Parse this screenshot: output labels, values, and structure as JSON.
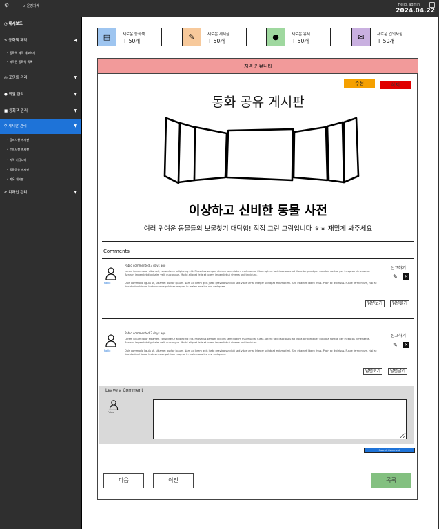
{
  "topbar": {
    "logo": "⚙",
    "home": "운영자계",
    "greeting": "Hello, admin",
    "date": "2024.04.22"
  },
  "sidebar": {
    "items": [
      {
        "label": "대시보드",
        "icon": "speedometer-icon"
      },
      {
        "label": "동화책 제작",
        "icon": "pen-icon"
      },
      {
        "label": "포인트 관리",
        "icon": "coin-icon"
      },
      {
        "label": "회원 관리",
        "icon": "user-icon"
      },
      {
        "label": "동화책 관리",
        "icon": "book-icon"
      },
      {
        "label": "게시판 관리",
        "icon": "board-icon"
      },
      {
        "label": "디자인 관리",
        "icon": "brush-icon"
      }
    ],
    "sub_create": [
      "동화책 제작 레포하기",
      "제작된 동화책 목록"
    ],
    "sub_board": [
      "공지사항 게시판",
      "건의사항 게시판",
      "지역 커뮤니티",
      "동화공유 게시판",
      "자유 게시판"
    ]
  },
  "stats": [
    {
      "label": "새로운 동화책",
      "value": "+ 50개",
      "color": "#9ec5f0",
      "icon": "book-icon"
    },
    {
      "label": "새로운 게시글",
      "value": "+ 50개",
      "color": "#f7c99b",
      "icon": "pencil-icon"
    },
    {
      "label": "새로운 유저",
      "value": "+ 50개",
      "color": "#9fd89f",
      "icon": "user-icon"
    },
    {
      "label": "새로운 건의사항",
      "value": "+ 50개",
      "color": "#c9b0e0",
      "icon": "inbox-icon"
    }
  ],
  "board": {
    "category": "지역 커뮤니티",
    "edit_label": "수정",
    "delete_label": "삭제",
    "title": "동화 공유 게시판",
    "post_heading": "이상하고 신비한 동물 사전",
    "post_desc": "여러 귀여운 동물들의 보물찾기 대탐험! 직접 그린 그림입니다 ㅎㅎ 재밌게 봐주세요",
    "comments_label": "Comments"
  },
  "comments": [
    {
      "author": "Pablo",
      "meta": "Pablo commented 3 days ago",
      "text1": "Lorem ipsum dolor sit amet, consectetur adipiscing elit. Phasellus semper dictum sem dictum malesuada. Class aptent taciti sociosqu ad litora torquent per conubia nostra, per inceptos himenaeos. Aenean imperdiet dignissim velit eu congue. Morbi aliquet felis et lorem imperdiet ut viverra orci tincidunt.",
      "text2": "Duis commodo ligula ut, sit amet auctor ipsum. Nam ac lorem quis justo gravida suscipit sed vitae urna. Integer volutpat euismod mi. Sed et amet libero risus. Proin ac dui risus. Fusce fermentum, nisi ac tincidunt vehicula, lectus neque pulvinar magna, in malesuada leo nisl sed quam.",
      "report": "신고하기",
      "reply_view": "답변보기",
      "reply_write": "답변달기"
    },
    {
      "author": "Pablo",
      "meta": "Pablo commented 3 days ago",
      "text1": "Lorem ipsum dolor sit amet, consectetur adipiscing elit. Phasellus semper dictum sem dictum malesuada. Class aptent taciti sociosqu ad litora torquent per conubia nostra, per inceptos himenaeos. Aenean imperdiet dignissim velit eu congue. Morbi aliquet felis et lorem imperdiet ut viverra orci tincidunt.",
      "text2": "Duis commodo ligula ut, sit amet auctor ipsum. Nam ac lorem quis justo gravida suscipit sed vitae urna. Integer volutpat euismod mi. Sed et amet libero risus. Proin ac dui risus. Fusce fermentum, nisi ac tincidunt vehicula, lectus neque pulvinar magna, in malesuada leo nisl sed quam.",
      "report": "신고하기",
      "reply_view": "답변보기",
      "reply_write": "답변달기"
    }
  ],
  "leave": {
    "label": "Leave a Comment",
    "author": "Pablo",
    "submit": "Submit Comment"
  },
  "footer": {
    "next": "다음",
    "prev": "이전",
    "list": "목록"
  }
}
